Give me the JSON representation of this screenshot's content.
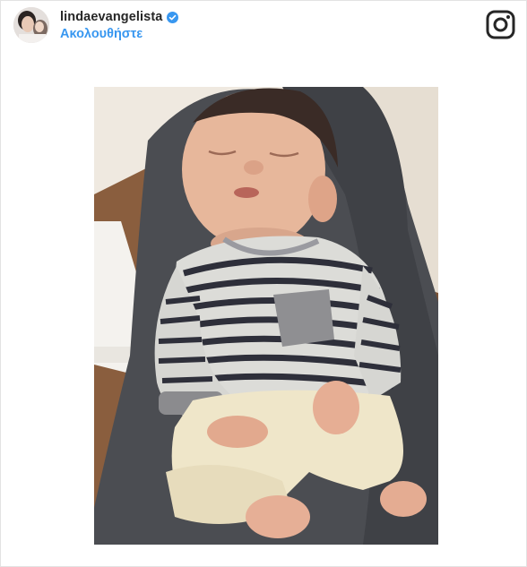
{
  "post": {
    "username": "lindaevangelista",
    "follow_label": "Ακολουθήστε",
    "verified": true
  },
  "icons": {
    "verified": "verified-badge-icon",
    "brand": "instagram-icon"
  },
  "colors": {
    "accent": "#3897f0",
    "text": "#262626",
    "border": "#e3e3e3"
  }
}
